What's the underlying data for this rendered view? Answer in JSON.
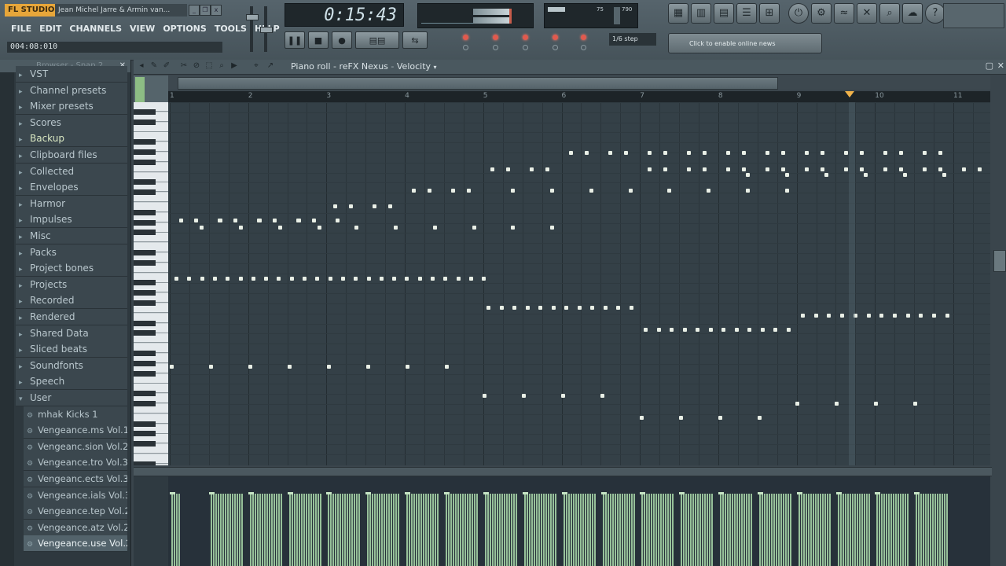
{
  "app": {
    "logo": "FL STUDIO",
    "song_title": "Jean Michel Jarre & Armin van...",
    "window_buttons": [
      "_",
      "❐",
      "x"
    ]
  },
  "menu": [
    "FILE",
    "EDIT",
    "CHANNELS",
    "VIEW",
    "OPTIONS",
    "TOOLS",
    "HELP"
  ],
  "hint_bar": "004:08:010",
  "time": "0:15:43",
  "monitor": {
    "cpu": "75",
    "ram": "790"
  },
  "step_display": "1/6 step",
  "online_news": "Click to enable online news",
  "browser": {
    "header": "Browser - Snap 2",
    "items": [
      {
        "label": "VST",
        "type": "folder"
      },
      {
        "label": "Channel presets",
        "type": "folder"
      },
      {
        "label": "Mixer presets",
        "type": "folder"
      },
      {
        "label": "Scores",
        "type": "folder"
      },
      {
        "label": "Backup",
        "type": "folder",
        "highlight": true
      },
      {
        "label": "Clipboard files",
        "type": "folder"
      },
      {
        "label": "Collected",
        "type": "folder"
      },
      {
        "label": "Envelopes",
        "type": "folder"
      },
      {
        "label": "Harmor",
        "type": "folder"
      },
      {
        "label": "Impulses",
        "type": "folder"
      },
      {
        "label": "Misc",
        "type": "folder"
      },
      {
        "label": "Packs",
        "type": "folder"
      },
      {
        "label": "Project bones",
        "type": "folder"
      },
      {
        "label": "Projects",
        "type": "folder"
      },
      {
        "label": "Recorded",
        "type": "folder"
      },
      {
        "label": "Rendered",
        "type": "folder"
      },
      {
        "label": "Shared Data",
        "type": "folder"
      },
      {
        "label": "Sliced beats",
        "type": "folder"
      },
      {
        "label": "Soundfonts",
        "type": "folder"
      },
      {
        "label": "Speech",
        "type": "folder"
      },
      {
        "label": "User",
        "type": "folder-open"
      },
      {
        "label": "mhak Kicks 1",
        "type": "sub"
      },
      {
        "label": "Vengeance.ms Vol.1",
        "type": "sub"
      },
      {
        "label": "Vengeanc.sion Vol.2",
        "type": "sub"
      },
      {
        "label": "Vengeance.tro Vol.3",
        "type": "sub"
      },
      {
        "label": "Vengeanc.ects Vol.3",
        "type": "sub"
      },
      {
        "label": "Vengeance.ials Vol.3",
        "type": "sub"
      },
      {
        "label": "Vengeance.tep Vol.2",
        "type": "sub"
      },
      {
        "label": "Vengeance.atz Vol.2",
        "type": "sub"
      },
      {
        "label": "Vengeance.use Vol.2",
        "type": "sub",
        "selected": true
      }
    ]
  },
  "piano_roll": {
    "title": "Piano roll - reFX Nexus",
    "target": "Velocity",
    "bars": [
      "1",
      "2",
      "3",
      "4",
      "5",
      "6",
      "7",
      "8",
      "9",
      "10",
      "11"
    ]
  },
  "colors": {
    "accent": "#f0b24a",
    "note": "#e9efe6",
    "velocity": "#97c19a",
    "background": "#344047"
  }
}
